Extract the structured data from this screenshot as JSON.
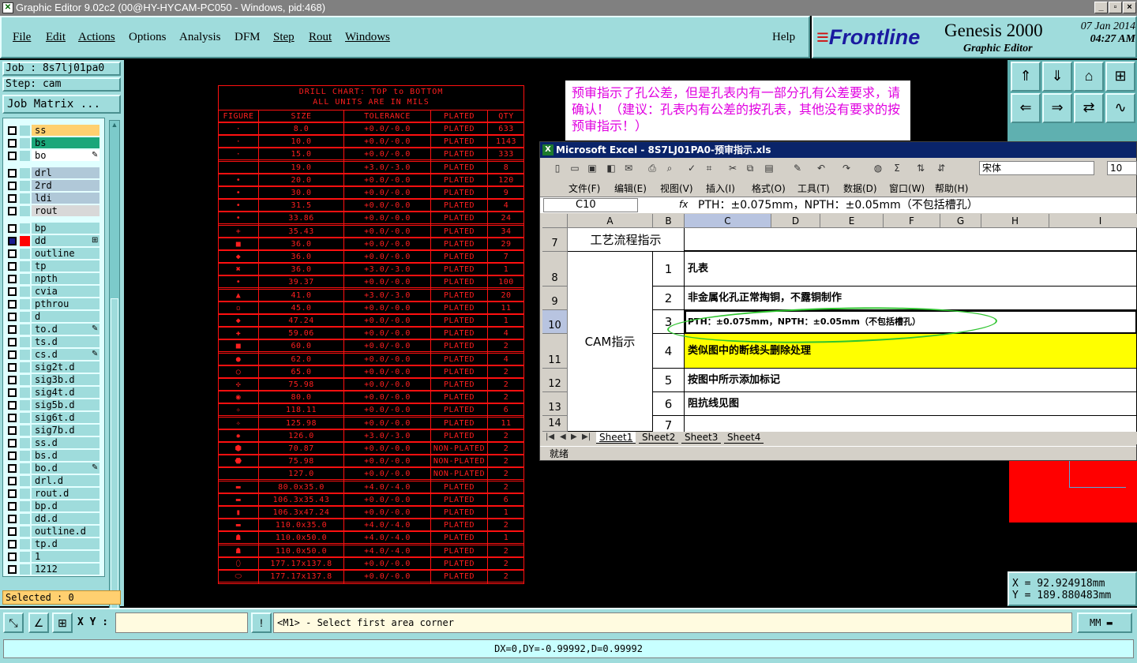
{
  "window": {
    "title": "Graphic Editor 9.02c2 (00@HY-HYCAM-PC050 - Windows, pid:468)"
  },
  "menu": [
    "File",
    "Edit",
    "Actions",
    "Options",
    "Analysis",
    "DFM",
    "Step",
    "Rout",
    "Windows"
  ],
  "help": "Help",
  "brand": {
    "logo": "Frontline",
    "product": "Genesis 2000",
    "subtitle": "Graphic Editor",
    "date": "07 Jan 2014",
    "time": "04:27 AM"
  },
  "job": "Job : 8s7lj01pa0",
  "step": "Step: cam",
  "job_matrix": "Job Matrix ...",
  "layers": [
    {
      "name": "ss",
      "color": "#ffd070"
    },
    {
      "name": "bs",
      "color": "#1aa77a"
    },
    {
      "name": "bo",
      "color": "#ffffff",
      "badge": "✎"
    },
    {
      "divider": true
    },
    {
      "name": "drl",
      "color": "#b0c8d8"
    },
    {
      "name": "2rd",
      "color": "#b0c8d8"
    },
    {
      "name": "ldi",
      "color": "#b0c8d8"
    },
    {
      "name": "rout",
      "color": "#d8d8d8"
    },
    {
      "divider": true
    },
    {
      "name": "bp"
    },
    {
      "name": "dd",
      "selected": true,
      "badge": "⊞"
    },
    {
      "name": "outline"
    },
    {
      "name": "tp"
    },
    {
      "name": "npth"
    },
    {
      "name": "cvia"
    },
    {
      "name": "pthrou"
    },
    {
      "name": "d"
    },
    {
      "name": "to.d",
      "badge": "✎"
    },
    {
      "name": "ts.d"
    },
    {
      "name": "cs.d",
      "badge": "✎"
    },
    {
      "name": "sig2t.d"
    },
    {
      "name": "sig3b.d"
    },
    {
      "name": "sig4t.d"
    },
    {
      "name": "sig5b.d"
    },
    {
      "name": "sig6t.d"
    },
    {
      "name": "sig7b.d"
    },
    {
      "name": "ss.d"
    },
    {
      "name": "bs.d"
    },
    {
      "name": "bo.d",
      "badge": "✎"
    },
    {
      "name": "drl.d"
    },
    {
      "name": "rout.d"
    },
    {
      "name": "bp.d"
    },
    {
      "name": "dd.d"
    },
    {
      "name": "outline.d"
    },
    {
      "name": "tp.d"
    },
    {
      "name": "1"
    },
    {
      "name": "1212"
    }
  ],
  "selected": "Selected : 0",
  "drill_chart": {
    "title1": "DRILL CHART: TOP to BOTTOM",
    "title2": "ALL UNITS ARE IN MILS",
    "headers": [
      "FIGURE",
      "SIZE",
      "TOLERANCE",
      "PLATED",
      "QTY"
    ],
    "rows": [
      [
        "·",
        "8.0",
        "+0.0/-0.0",
        "PLATED",
        "633"
      ],
      [
        "·",
        "10.0",
        "+0.0/-0.0",
        "PLATED",
        "1143"
      ],
      [
        "·",
        "15.0",
        "+0.0/-0.0",
        "PLATED",
        "333"
      ],
      [
        "",
        "19.0",
        "+3.0/-3.0",
        "PLATED",
        "8"
      ],
      [
        "•",
        "20.0",
        "+0.0/-0.0",
        "PLATED",
        "120"
      ],
      [
        "•",
        "30.0",
        "+0.0/-0.0",
        "PLATED",
        "9"
      ],
      [
        "•",
        "31.5",
        "+0.0/-0.0",
        "PLATED",
        "4"
      ],
      [
        "•",
        "33.86",
        "+0.0/-0.0",
        "PLATED",
        "24"
      ],
      [
        "+",
        "35.43",
        "+0.0/-0.0",
        "PLATED",
        "34"
      ],
      [
        "■",
        "36.0",
        "+0.0/-0.0",
        "PLATED",
        "29"
      ],
      [
        "◆",
        "36.0",
        "+0.0/-0.0",
        "PLATED",
        "7"
      ],
      [
        "✖",
        "36.0",
        "+3.0/-3.0",
        "PLATED",
        "1"
      ],
      [
        "•",
        "39.37",
        "+0.0/-0.0",
        "PLATED",
        "100"
      ],
      [
        "▲",
        "41.0",
        "+3.0/-3.0",
        "PLATED",
        "20"
      ],
      [
        "▫",
        "45.0",
        "+0.0/-0.0",
        "PLATED",
        "11"
      ],
      [
        "◆",
        "47.24",
        "+0.0/-0.0",
        "PLATED",
        "1"
      ],
      [
        "✚",
        "59.06",
        "+0.0/-0.0",
        "PLATED",
        "4"
      ],
      [
        "■",
        "60.0",
        "+0.0/-0.0",
        "PLATED",
        "2"
      ],
      [
        "●",
        "62.0",
        "+0.0/-0.0",
        "PLATED",
        "4"
      ],
      [
        "○",
        "65.0",
        "+0.0/-0.0",
        "PLATED",
        "2"
      ],
      [
        "✣",
        "75.98",
        "+0.0/-0.0",
        "PLATED",
        "2"
      ],
      [
        "◉",
        "80.0",
        "+0.0/-0.0",
        "PLATED",
        "2"
      ],
      [
        "✧",
        "118.11",
        "+0.0/-0.0",
        "PLATED",
        "6"
      ],
      [
        "✧",
        "125.98",
        "+0.0/-0.0",
        "PLATED",
        "11"
      ],
      [
        "✹",
        "126.0",
        "+3.0/-3.0",
        "PLATED",
        "2"
      ],
      [
        "⬢",
        "70.87",
        "+0.0/-0.0",
        "NON-PLATED",
        "2"
      ],
      [
        "⬣",
        "75.98",
        "+0.0/-0.0",
        "NON-PLATED",
        "2"
      ],
      [
        "",
        "127.0",
        "+0.0/-0.0",
        "NON-PLATED",
        "2"
      ],
      [
        "▬",
        "80.0x35.0",
        "+4.0/-4.0",
        "PLATED",
        "2"
      ],
      [
        "▬",
        "106.3x35.43",
        "+0.0/-0.0",
        "PLATED",
        "6"
      ],
      [
        "▮",
        "106.3x47.24",
        "+0.0/-0.0",
        "PLATED",
        "1"
      ],
      [
        "▬",
        "110.0x35.0",
        "+4.0/-4.0",
        "PLATED",
        "2"
      ],
      [
        "☗",
        "110.0x50.0",
        "+4.0/-4.0",
        "PLATED",
        "1"
      ],
      [
        "☗",
        "110.0x50.0",
        "+4.0/-4.0",
        "PLATED",
        "2"
      ],
      [
        "⬯",
        "177.17x137.8",
        "+0.0/-0.0",
        "PLATED",
        "2"
      ],
      [
        "⬭",
        "177.17x137.8",
        "+0.0/-0.0",
        "PLATED",
        "2"
      ]
    ]
  },
  "note": "预审指示了孔公差，但是孔表内有一部分孔有公差要求，请确认！（建议：孔表内有公差的按孔表，其他没有要求的按预审指示！）",
  "excel": {
    "title": "Microsoft Excel - 8S7LJ01PA0-预审指示.xls",
    "font": "宋体",
    "size": "10",
    "menus": [
      "文件(F)",
      "编辑(E)",
      "视图(V)",
      "插入(I)",
      "格式(O)",
      "工具(T)",
      "数据(D)",
      "窗口(W)",
      "帮助(H)"
    ],
    "cell_ref": "C10",
    "formula": "PTH：±0.075mm，NPTH：±0.05mm（不包括槽孔）",
    "columns": [
      "A",
      "B",
      "C",
      "D",
      "E",
      "F",
      "G",
      "H",
      "I"
    ],
    "rows": [
      "7",
      "8",
      "9",
      "10",
      "11",
      "12",
      "13",
      "14"
    ],
    "header_cell": "工艺流程指示",
    "cam_label": "CAM指示",
    "items": [
      {
        "num": "1",
        "text": "孔表"
      },
      {
        "num": "2",
        "text": "非金属化孔正常掏铜，不露铜制作"
      },
      {
        "num": "3",
        "text": "PTH：±0.075mm，NPTH：±0.05mm（不包括槽孔）"
      },
      {
        "num": "4",
        "text": "类似图中的断线头删除处理"
      },
      {
        "num": "5",
        "text": "按图中所示添加标记"
      },
      {
        "num": "6",
        "text": "阻抗线见图"
      },
      {
        "num": "7",
        "text": ""
      }
    ],
    "sheets": [
      "Sheet1",
      "Sheet2",
      "Sheet3",
      "Sheet4"
    ],
    "status": "就绪"
  },
  "coords": {
    "x": "X = 92.924918mm",
    "y": "Y = 189.880483mm"
  },
  "xy_label": "X Y :",
  "prompt": "<M1> - Select first area corner",
  "units": "MM",
  "status_line": "DX=0,DY=-0.99992,D=0.99992",
  "colors": {
    "panel": "#9fdcdc",
    "drill": "#ff1f1f",
    "note": "#e000e0",
    "highlight": "#ffff00"
  }
}
